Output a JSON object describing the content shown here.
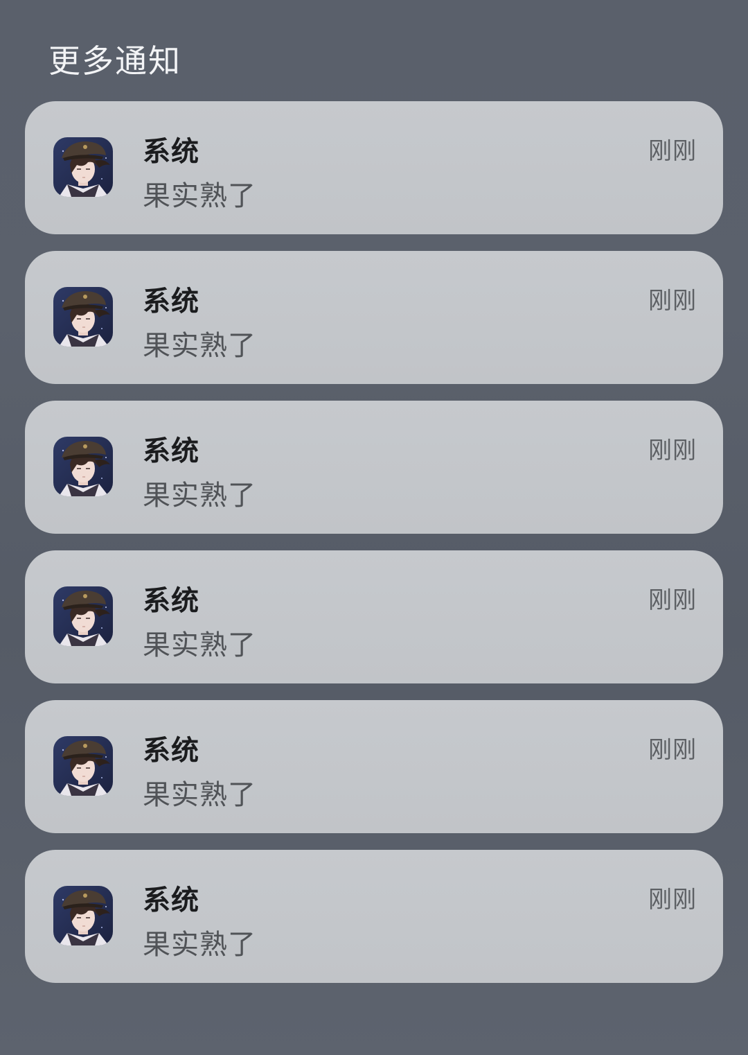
{
  "header": {
    "title": "更多通知"
  },
  "notifications": [
    {
      "app_icon": "app-avatar-icon",
      "title": "系统",
      "body": "果实熟了",
      "time": "刚刚"
    },
    {
      "app_icon": "app-avatar-icon",
      "title": "系统",
      "body": "果实熟了",
      "time": "刚刚"
    },
    {
      "app_icon": "app-avatar-icon",
      "title": "系统",
      "body": "果实熟了",
      "time": "刚刚"
    },
    {
      "app_icon": "app-avatar-icon",
      "title": "系统",
      "body": "果实熟了",
      "time": "刚刚"
    },
    {
      "app_icon": "app-avatar-icon",
      "title": "系统",
      "body": "果实熟了",
      "time": "刚刚"
    },
    {
      "app_icon": "app-avatar-icon",
      "title": "系统",
      "body": "果实熟了",
      "time": "刚刚"
    }
  ]
}
